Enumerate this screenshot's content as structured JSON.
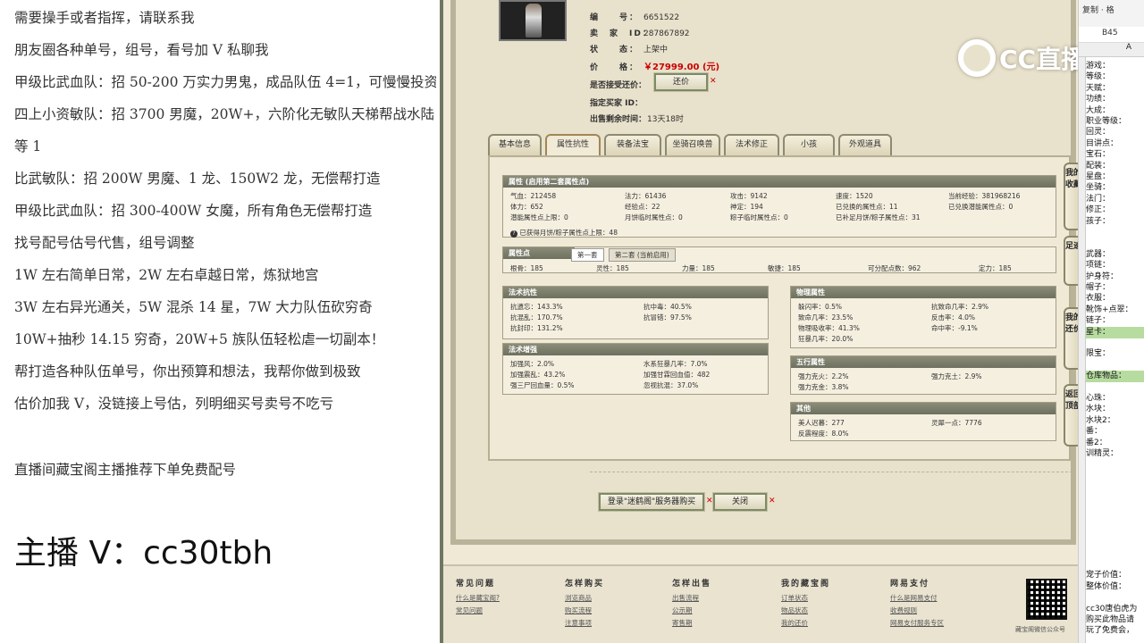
{
  "left_text": {
    "lines": [
      "需要操手或者指挥，请联系我",
      "朋友圈各种单号，组号，看号加 V 私聊我",
      "甲级比武血队：招 50-200 万实力男鬼，成品队伍 4=1，可慢慢投资",
      "四上小资敏队：招 3700 男魔，20W+，六阶化无敏队天梯帮战水陆",
      "等 1",
      "比武敏队：招 200W 男魔、1 龙、150W2 龙，无偿帮打造",
      "甲级比武血队：招 300-400W 女魔，所有角色无偿帮打造",
      "找号配号估号代售，组号调整",
      "1W 左右简单日常，2W 左右卓越日常，炼狱地宫",
      "3W 左右异光通关，5W 混杀 14 星，7W 大力队伍砍穷奇",
      "10W+抽秒 14.15 穷奇，20W+5 族队伍轻松虐一切副本！",
      "帮打造各种队伍单号，你出预算和想法，我帮你做到极致",
      "估价加我 V，没链接上号估，列明细买号卖号不吃亏",
      "直播间藏宝阁主播推荐下单免费配号"
    ],
    "big": "主播 V：cc30tbh"
  },
  "item": {
    "id_label": "编　　号：",
    "id_value": "6651522",
    "seller_label": "卖　家　ID：",
    "seller_value": "287867892",
    "status_label": "状　　态：",
    "status_value": "上架中",
    "price_label": "价　　格：",
    "price_value": "￥27999.00 (元)",
    "bargain_label": "是否接受还价：",
    "bargain_button": "还价",
    "buyer_label": "指定买家 ID：",
    "remain_label": "出售剩余时间：",
    "remain_value": "13天18时"
  },
  "tabs": [
    "基本信息",
    "属性抗性",
    "装备法宝",
    "坐骑召唤兽",
    "法术修正",
    "小孩",
    "外观道具"
  ],
  "attributes": {
    "title": "属性 (启用第二套属性点)",
    "rows": [
      [
        "气血：212458",
        "法力：61436",
        "攻击：9142",
        "速度：1520",
        "当前经验：381968216"
      ],
      [
        "体力：652",
        "经验点：22",
        "神定：194",
        "已兑换的属性点：11",
        "已兑换潜能属性点：0"
      ],
      [
        "潜能属性点上限：0",
        "月饼临时属性点：0",
        "粽子临时属性点：0",
        "已补足月饼/粽子属性点：31",
        ""
      ]
    ],
    "note": "已获得月饼/粽子属性点上限：48"
  },
  "points": {
    "title": "属性点",
    "tab1": "第一套",
    "tab2": "第二套 (当前启用)",
    "values": [
      "根骨：185",
      "灵性：185",
      "力量：185",
      "敏捷：185",
      "可分配点数：962",
      "定力：185"
    ]
  },
  "spell_resist": {
    "title": "法术抗性",
    "cells": [
      "抗遗忘：143.3%",
      "抗中毒：40.5%",
      "抗混乱：170.7%",
      "抗冒错：97.5%",
      "抗封印：131.2%"
    ]
  },
  "spell_boost": {
    "title": "法术增强",
    "cells": [
      "加强风：2.0%",
      "水系狂暴几率：7.0%",
      "加强震乱：43.2%",
      "加强甘霖回血值：482",
      "强三尸回血量：0.5%",
      "忽视抗混：37.0%"
    ]
  },
  "physical": {
    "title": "物理属性",
    "cells": [
      "躲闪率：0.5%",
      "抗致命几率：2.9%",
      "致命几率：23.5%",
      "反击率：4.0%",
      "物理吸收率：41.3%",
      "命中率：-9.1%",
      "狂暴几率：20.0%"
    ]
  },
  "five": {
    "title": "五行属性",
    "cells": [
      "强力克火：2.2%",
      "强力克土：2.9%",
      "强力克金：3.8%"
    ]
  },
  "other": {
    "title": "其他",
    "cells": [
      "美人迟暮：277",
      "灵犀一点：7776",
      "反震程度：8.0%"
    ]
  },
  "side_buttons": [
    "我的收藏",
    "足迹",
    "我的还价",
    "返回顶部"
  ],
  "bottom_buttons": {
    "login": "登录\"迷鹤阁\"服务器购买",
    "close": "关闭"
  },
  "footer": {
    "cols": [
      {
        "title": "常见问题",
        "links": [
          "什么是藏宝阁?",
          "常见问题"
        ]
      },
      {
        "title": "怎样购买",
        "links": [
          "浏览商品",
          "购买流程",
          "注意事项"
        ]
      },
      {
        "title": "怎样出售",
        "links": [
          "出售流程",
          "公示期",
          "寄售期"
        ]
      },
      {
        "title": "我的藏宝阁",
        "links": [
          "订单状态",
          "物品状态",
          "我的还价"
        ]
      },
      {
        "title": "网易支付",
        "links": [
          "什么是网易支付",
          "收费规则",
          "网易支付服务专区"
        ]
      }
    ],
    "qr_caption": "藏宝阁微信公众号"
  },
  "logo_text": "CC直播",
  "sheet": {
    "toolbar": "复制 · 格",
    "namebox": "B45",
    "col": "A",
    "rows": [
      "游戏：",
      "等级：",
      "天赋：",
      "功绩：",
      "大成：",
      "职业等级：",
      "回灵：",
      "目讲点：",
      "宝石：",
      "配装：",
      "星盘：",
      "坐骑：",
      "法门：",
      "修正：",
      "孩子：",
      "",
      "",
      "武器：",
      "项链：",
      "护身符：",
      "帽子：",
      "衣服：",
      "靴饰+点翠：",
      "链子：",
      "星卡：",
      "",
      "限宝：",
      "",
      "仓库物品：",
      "",
      "心珠：",
      "水块：",
      "水块2：",
      "番：",
      "番2：",
      "训精灵：",
      "",
      "",
      "",
      "",
      "",
      "",
      "",
      "",
      "",
      "",
      "宠子价值：",
      "整体价值：",
      "",
      "cc30唐伯虎为",
      "购买此物品请",
      "玩了免费会，"
    ],
    "highlight_rows": [
      24,
      28
    ]
  },
  "colors": {
    "accent_price": "#cc0000",
    "panel_header": "#7a7c6a",
    "sheet_highlight": "#b7dca0"
  }
}
